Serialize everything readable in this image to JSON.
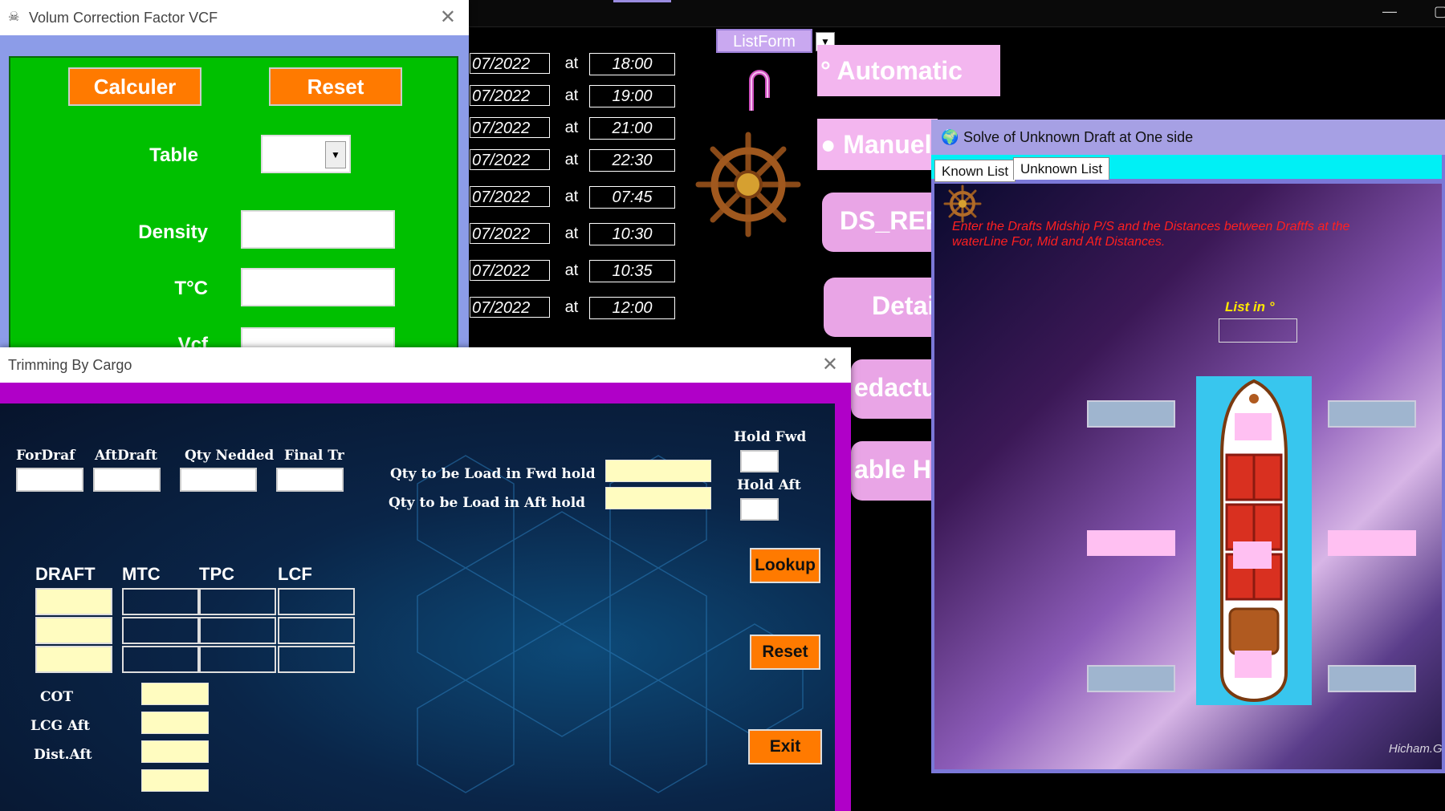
{
  "background_app": {
    "dates": [
      "07/2022",
      "07/2022",
      "07/2022",
      "07/2022",
      "07/2022",
      "07/2022",
      "07/2022",
      "07/2022"
    ],
    "at_label": "at",
    "times": [
      "18:00",
      "19:00",
      "21:00",
      "22:30",
      "07:45",
      "10:30",
      "10:35",
      "12:00"
    ],
    "listform_label": "ListForm",
    "buttons": {
      "automatic": "Automatic",
      "manuel": "Manuel",
      "ds_rep": "DS_REP",
      "detai": "Detai",
      "redactu": "edactu",
      "table_h": "able H"
    }
  },
  "vcf_window": {
    "title": "Volum Correction Factor VCF",
    "calculer": "Calculer",
    "reset": "Reset",
    "table_label": "Table",
    "density_label": "Density",
    "temp_label": "T°C",
    "vcf_label": "Vcf"
  },
  "trimming_window": {
    "title": "Trimming By Cargo",
    "fordraf": "ForDraf",
    "aftdraft": "AftDraft",
    "qty_nedded": "Qty Nedded",
    "final_tr": "Final Tr",
    "qty_fwd": "Qty to be Load in Fwd hold",
    "qty_aft": "Qty to be Load in Aft hold",
    "hold_fwd": "Hold Fwd",
    "hold_aft": "Hold Aft",
    "table_headers": [
      "DRAFT",
      "MTC",
      "TPC",
      "LCF"
    ],
    "lookup": "Lookup",
    "reset": "Reset",
    "exit": "Exit",
    "cot": "COT",
    "lcg_aft": "LCG Aft",
    "dist_aft": "Dist.Aft"
  },
  "solve_window": {
    "title": "Solve of Unknown Draft at One side",
    "tabs": [
      "Known List",
      "Unknown List"
    ],
    "instructions": "Enter the Drafts Midship P/S and the Distances between Draftfs at the waterLine For, Mid and Aft Distances.",
    "list_label": "List in °",
    "watermark": "Hicham.G"
  }
}
